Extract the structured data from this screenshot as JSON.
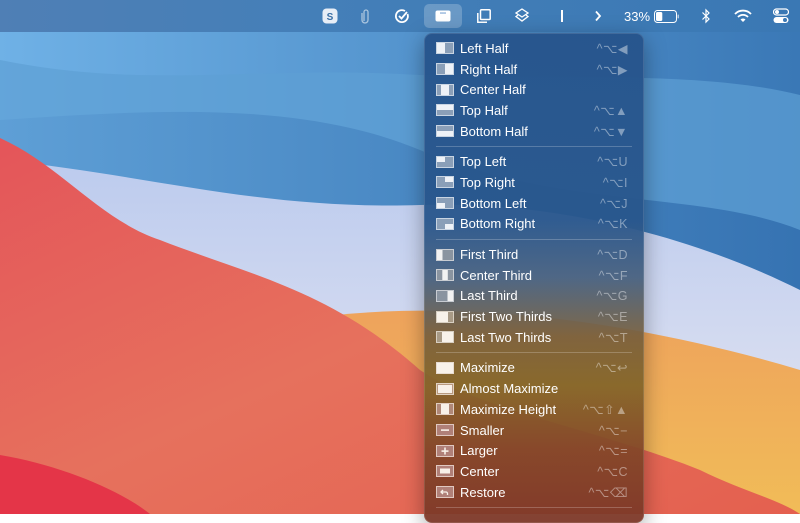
{
  "menubar": {
    "items": [
      {
        "name": "skype-icon",
        "label": "S"
      },
      {
        "name": "paperclip-icon"
      },
      {
        "name": "checkmark-circle-icon"
      },
      {
        "name": "window-manager-icon",
        "active": true
      },
      {
        "name": "window-resize-icon"
      },
      {
        "name": "layers-icon"
      },
      {
        "name": "text-cursor-icon"
      },
      {
        "name": "chevron-right-icon"
      }
    ],
    "battery_percent_label": "33%",
    "battery_level": 0.33,
    "status_icons": [
      "bluetooth-icon",
      "wifi-icon",
      "control-center-icon"
    ]
  },
  "menu": {
    "groups": [
      [
        {
          "label": "Left Half",
          "shortcut": "^⌥◀",
          "icon": "left-half"
        },
        {
          "label": "Right Half",
          "shortcut": "^⌥▶",
          "icon": "right-half"
        },
        {
          "label": "Center Half",
          "shortcut": "",
          "icon": "center-half"
        },
        {
          "label": "Top Half",
          "shortcut": "^⌥▲",
          "icon": "top-half"
        },
        {
          "label": "Bottom Half",
          "shortcut": "^⌥▼",
          "icon": "bottom-half"
        }
      ],
      [
        {
          "label": "Top Left",
          "shortcut": "^⌥U",
          "icon": "top-left"
        },
        {
          "label": "Top Right",
          "shortcut": "^⌥I",
          "icon": "top-right"
        },
        {
          "label": "Bottom Left",
          "shortcut": "^⌥J",
          "icon": "bottom-left"
        },
        {
          "label": "Bottom Right",
          "shortcut": "^⌥K",
          "icon": "bottom-right"
        }
      ],
      [
        {
          "label": "First Third",
          "shortcut": "^⌥D",
          "icon": "first-third"
        },
        {
          "label": "Center Third",
          "shortcut": "^⌥F",
          "icon": "center-third"
        },
        {
          "label": "Last Third",
          "shortcut": "^⌥G",
          "icon": "last-third"
        },
        {
          "label": "First Two Thirds",
          "shortcut": "^⌥E",
          "icon": "first-two-thirds"
        },
        {
          "label": "Last Two Thirds",
          "shortcut": "^⌥T",
          "icon": "last-two-thirds"
        }
      ],
      [
        {
          "label": "Maximize",
          "shortcut": "^⌥↩",
          "icon": "maximize"
        },
        {
          "label": "Almost Maximize",
          "shortcut": "",
          "icon": "almost-maximize"
        },
        {
          "label": "Maximize Height",
          "shortcut": "^⌥⇧▲",
          "icon": "maximize-height"
        },
        {
          "label": "Smaller",
          "shortcut": "^⌥−",
          "icon": "smaller"
        },
        {
          "label": "Larger",
          "shortcut": "^⌥=",
          "icon": "larger"
        },
        {
          "label": "Center",
          "shortcut": "^⌥C",
          "icon": "center"
        },
        {
          "label": "Restore",
          "shortcut": "^⌥⌫",
          "icon": "restore"
        }
      ]
    ]
  }
}
